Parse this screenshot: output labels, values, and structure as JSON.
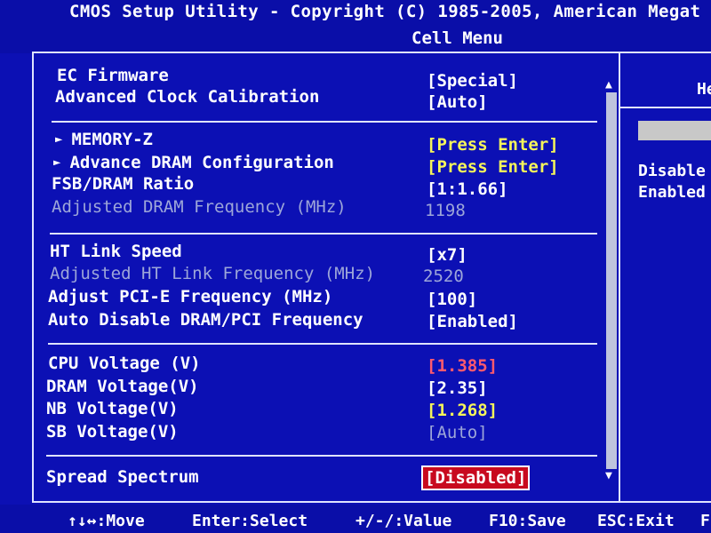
{
  "header": {
    "title": "CMOS Setup Utility - Copyright (C) 1985-2005, American Megat",
    "subtitle": "Cell Menu"
  },
  "settings": [
    {
      "label": "EC Firmware",
      "value": "[Special]",
      "state": "normal"
    },
    {
      "label": "Advanced Clock Calibration",
      "value": "[Auto]",
      "state": "normal"
    },
    {
      "label": "MEMORY-Z",
      "value": "[Press Enter]",
      "state": "yellow",
      "submenu": true
    },
    {
      "label": "Advance DRAM Configuration",
      "value": "[Press Enter]",
      "state": "yellow",
      "submenu": true
    },
    {
      "label": "FSB/DRAM Ratio",
      "value": "[1:1.66]",
      "state": "normal"
    },
    {
      "label": "Adjusted DRAM Frequency (MHz)",
      "value": "1198",
      "state": "dim"
    },
    {
      "label": "HT Link Speed",
      "value": "[x7]",
      "state": "normal"
    },
    {
      "label": "Adjusted HT Link Frequency (MHz)",
      "value": "2520",
      "state": "dim"
    },
    {
      "label": "Adjust PCI-E Frequency (MHz)",
      "value": "[100]",
      "state": "normal"
    },
    {
      "label": "Auto Disable DRAM/PCI Frequency",
      "value": "[Enabled]",
      "state": "normal"
    },
    {
      "label": "CPU Voltage (V)",
      "value": "[1.385]",
      "state": "red"
    },
    {
      "label": "DRAM Voltage(V)",
      "value": "[2.35]",
      "state": "normal"
    },
    {
      "label": "NB Voltage(V)",
      "value": "[1.268]",
      "state": "yellow"
    },
    {
      "label": "SB Voltage(V)",
      "value": "[Auto]",
      "state": "dim"
    },
    {
      "label": "Spread Spectrum",
      "value": "[Disabled]",
      "state": "selected"
    }
  ],
  "help": {
    "title": "He",
    "options": [
      "Disable",
      "Enabled"
    ]
  },
  "scrollbar": {
    "up": "▲",
    "down": "▼"
  },
  "submenu_marker": "►",
  "footer": {
    "move": "↑↓↔:Move",
    "select": "Enter:Select",
    "value": "+/-/:Value",
    "save": "F10:Save",
    "exit": "ESC:Exit",
    "f1": "F"
  },
  "colors": {
    "background": "#0c10b4",
    "text": "#ffffff",
    "dim_text": "#9da6d9",
    "highlight_yellow": "#f5f55a",
    "warning_red": "#ff5a6e",
    "selected_bg": "#c80a1e"
  }
}
